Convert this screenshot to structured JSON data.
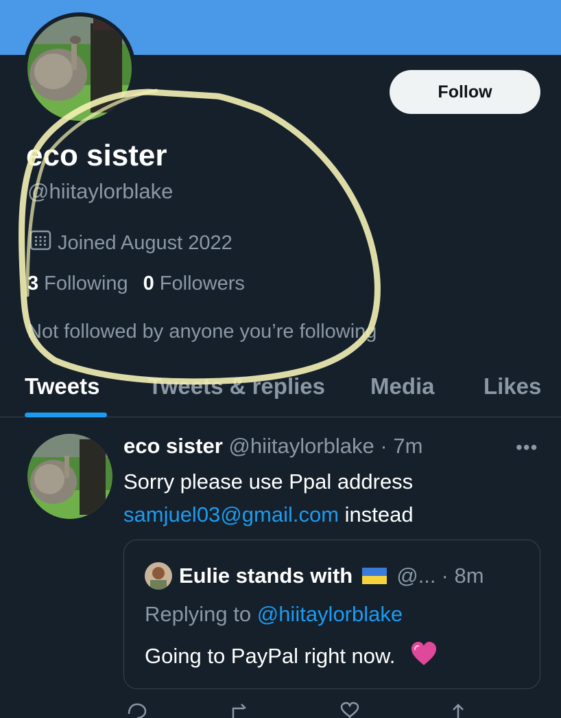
{
  "profile": {
    "display_name": "eco sister",
    "handle": "@hiitaylorblake",
    "joined": "Joined August 2022",
    "following_count": "3",
    "following_label": "Following",
    "followers_count": "0",
    "followers_label": "Followers",
    "not_followed_text": "Not followed by anyone you’re following",
    "follow_button_label": "Follow"
  },
  "tabs": [
    {
      "label": "Tweets",
      "active": true
    },
    {
      "label": "Tweets & replies",
      "active": false
    },
    {
      "label": "Media",
      "active": false
    },
    {
      "label": "Likes",
      "active": false
    }
  ],
  "tweet": {
    "author_name": "eco sister",
    "author_handle": "@hiitaylorblake",
    "separator": "·",
    "time": "7m",
    "more_icon": "more-horizontal-icon",
    "text_line1": "Sorry please use Ppal address",
    "email_link": "samjuel03@gmail.com",
    "text_line2_suffix": " instead",
    "quote": {
      "author_name": "Eulie stands with",
      "flag_icon": "ukraine-flag-icon",
      "author_handle": "@...",
      "time": "· 8m",
      "replying_prefix": "Replying to ",
      "replying_handle": "@hiitaylorblake",
      "text": "Going to PayPal right now."
    },
    "actions": [
      "reply-icon",
      "retweet-icon",
      "like-icon",
      "share-icon"
    ]
  },
  "colors": {
    "background": "#15202b",
    "banner": "#4a99e9",
    "accent": "#1d9bf0",
    "secondary_text": "#8b98a5",
    "divider": "#38444d",
    "highlight_scribble": "#f4f1b4"
  }
}
